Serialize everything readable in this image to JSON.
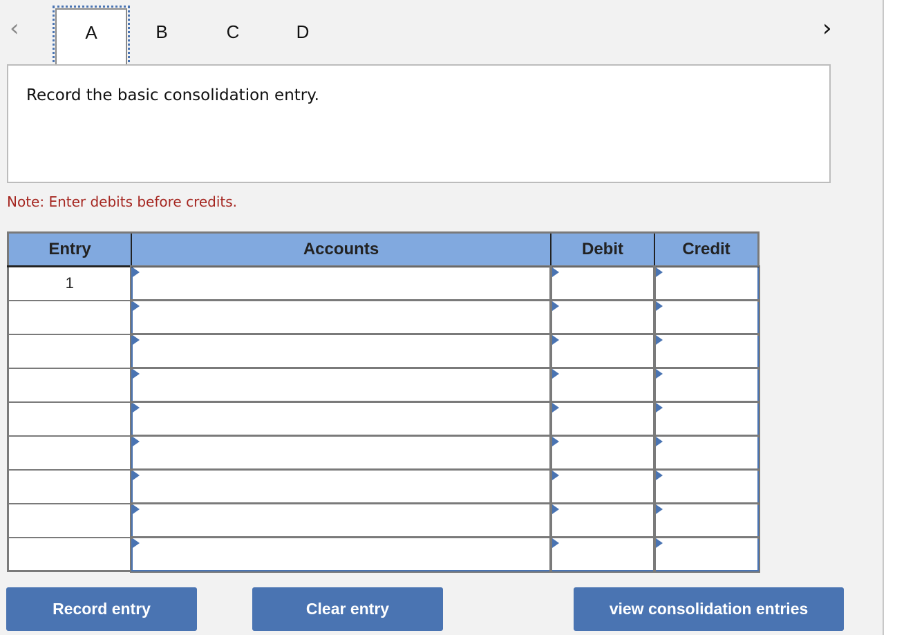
{
  "nav": {
    "prev_icon": "chevron-left-icon",
    "next_icon": "chevron-right-icon",
    "prev_glyph": "‹",
    "next_glyph": "›"
  },
  "tabs": [
    {
      "label": "A",
      "active": true
    },
    {
      "label": "B",
      "active": false
    },
    {
      "label": "C",
      "active": false
    },
    {
      "label": "D",
      "active": false
    }
  ],
  "question": {
    "text": "Record the basic consolidation entry."
  },
  "note": "Note: Enter debits before credits.",
  "journal": {
    "headers": [
      "Entry",
      "Accounts",
      "Debit",
      "Credit"
    ],
    "rows": [
      {
        "entry": "1",
        "account": "",
        "debit": "",
        "credit": ""
      },
      {
        "entry": "",
        "account": "",
        "debit": "",
        "credit": ""
      },
      {
        "entry": "",
        "account": "",
        "debit": "",
        "credit": ""
      },
      {
        "entry": "",
        "account": "",
        "debit": "",
        "credit": ""
      },
      {
        "entry": "",
        "account": "",
        "debit": "",
        "credit": ""
      },
      {
        "entry": "",
        "account": "",
        "debit": "",
        "credit": ""
      },
      {
        "entry": "",
        "account": "",
        "debit": "",
        "credit": ""
      },
      {
        "entry": "",
        "account": "",
        "debit": "",
        "credit": ""
      },
      {
        "entry": "",
        "account": "",
        "debit": "",
        "credit": ""
      }
    ]
  },
  "buttons": {
    "record": "Record entry",
    "clear": "Clear entry",
    "view": "view consolidation entries"
  },
  "colors": {
    "accent": "#4a74b2",
    "header_bg": "#81a9df",
    "note": "#a52620"
  }
}
